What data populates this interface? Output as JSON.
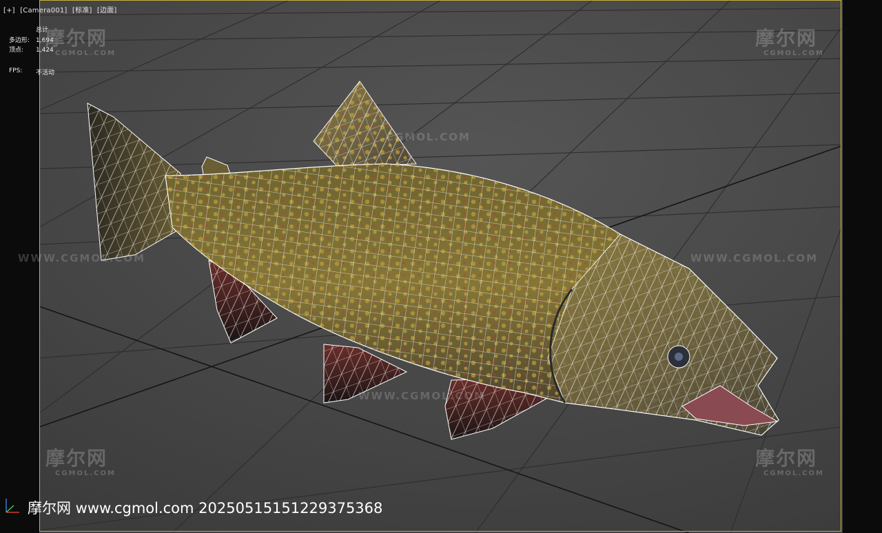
{
  "viewport": {
    "labels": [
      "[+]",
      "[Camera001]",
      "[标准]",
      "[边面]"
    ]
  },
  "stats": {
    "header": "总计",
    "polygons_label": "多边形:",
    "polygons_value": "1,694",
    "vertices_label": "顶点:",
    "vertices_value": "1,424",
    "fps_label": "FPS:",
    "fps_value": "不活动"
  },
  "watermarks": {
    "logo_text": "摩尔网",
    "logo_sub": "CGMOL.COM",
    "url_text": "WWW.CGMOL.COM"
  },
  "caption": "摩尔网 www.cgmol.com 20250515151229375368",
  "colors": {
    "viewport_bg": "#4a4a4a",
    "frame_border": "#c8b23a",
    "wire": "#ffffff",
    "fish_body": "#7a6a35"
  }
}
